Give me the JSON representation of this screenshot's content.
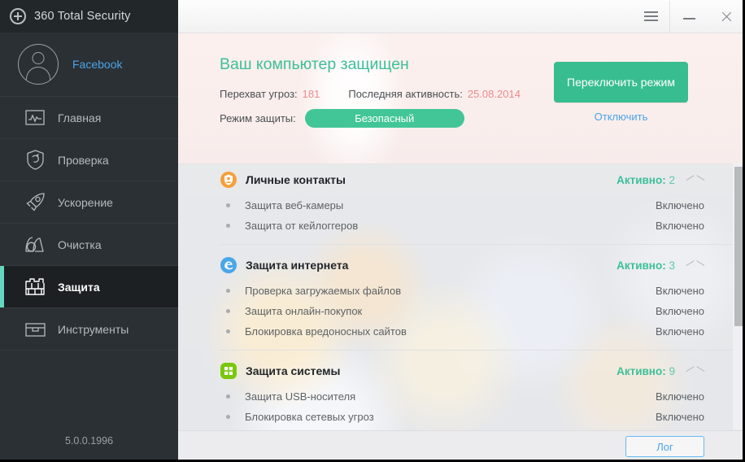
{
  "window": {
    "title": "360 Total Security",
    "logo_icon": "circle-plus-icon",
    "menu_icon": "hamburger-menu-icon",
    "minimize_icon": "minimize-icon",
    "close_icon": "close-icon"
  },
  "sidebar": {
    "account": {
      "name": "Facebook",
      "avatar_icon": "user-avatar-icon"
    },
    "items": [
      {
        "label": "Главная",
        "icon": "home-chart-icon",
        "active": false
      },
      {
        "label": "Проверка",
        "icon": "shield-scan-icon",
        "active": false
      },
      {
        "label": "Ускорение",
        "icon": "rocket-icon",
        "active": false
      },
      {
        "label": "Очистка",
        "icon": "vacuum-icon",
        "active": false
      },
      {
        "label": "Защита",
        "icon": "firewall-icon",
        "active": true
      },
      {
        "label": "Инструменты",
        "icon": "toolbox-icon",
        "active": false
      }
    ],
    "version": "5.0.0.1996"
  },
  "header": {
    "title": "Ваш компьютер защищен",
    "threats_label": "Перехват угроз:",
    "threats_value": "181",
    "activity_label": "Последняя активность:",
    "activity_value": "25.08.2014",
    "mode_label": "Режим защиты:",
    "mode_value": "Безопасный",
    "switch_button": "Переключить режим",
    "disable_link": "Отключить"
  },
  "groups": [
    {
      "title": "Личные контакты",
      "icon": "orange-shield-person-icon",
      "icon_color": "#f5a03c",
      "active_label": "Активно:",
      "active_count": "2",
      "collapse_icon": "chevron-up-icon",
      "items": [
        {
          "label": "Защита веб-камеры",
          "status": "Включено"
        },
        {
          "label": "Защита от кейлоггеров",
          "status": "Включено"
        }
      ]
    },
    {
      "title": "Защита интернета",
      "icon": "internet-explorer-icon",
      "icon_color": "#49a6e8",
      "active_label": "Активно:",
      "active_count": "3",
      "collapse_icon": "chevron-up-icon",
      "items": [
        {
          "label": "Проверка загружаемых файлов",
          "status": "Включено"
        },
        {
          "label": "Защита онлайн-покупок",
          "status": "Включено"
        },
        {
          "label": "Блокировка вредоносных сайтов",
          "status": "Включено"
        }
      ]
    },
    {
      "title": "Защита системы",
      "icon": "windows-system-icon",
      "icon_color": "#7ac70c",
      "active_label": "Активно:",
      "active_count": "9",
      "collapse_icon": "chevron-up-icon",
      "items": [
        {
          "label": "Защита USB-носителя",
          "status": "Включено"
        },
        {
          "label": "Блокировка сетевых угроз",
          "status": "Включено"
        }
      ]
    }
  ],
  "footer": {
    "log_button": "Лог"
  },
  "colors": {
    "accent_green": "#3dbf99",
    "link_blue": "#4ca3e8",
    "value_red": "#e98c8c",
    "sidebar_bg": "#2b3034",
    "active_bar": "#62d9bf"
  }
}
